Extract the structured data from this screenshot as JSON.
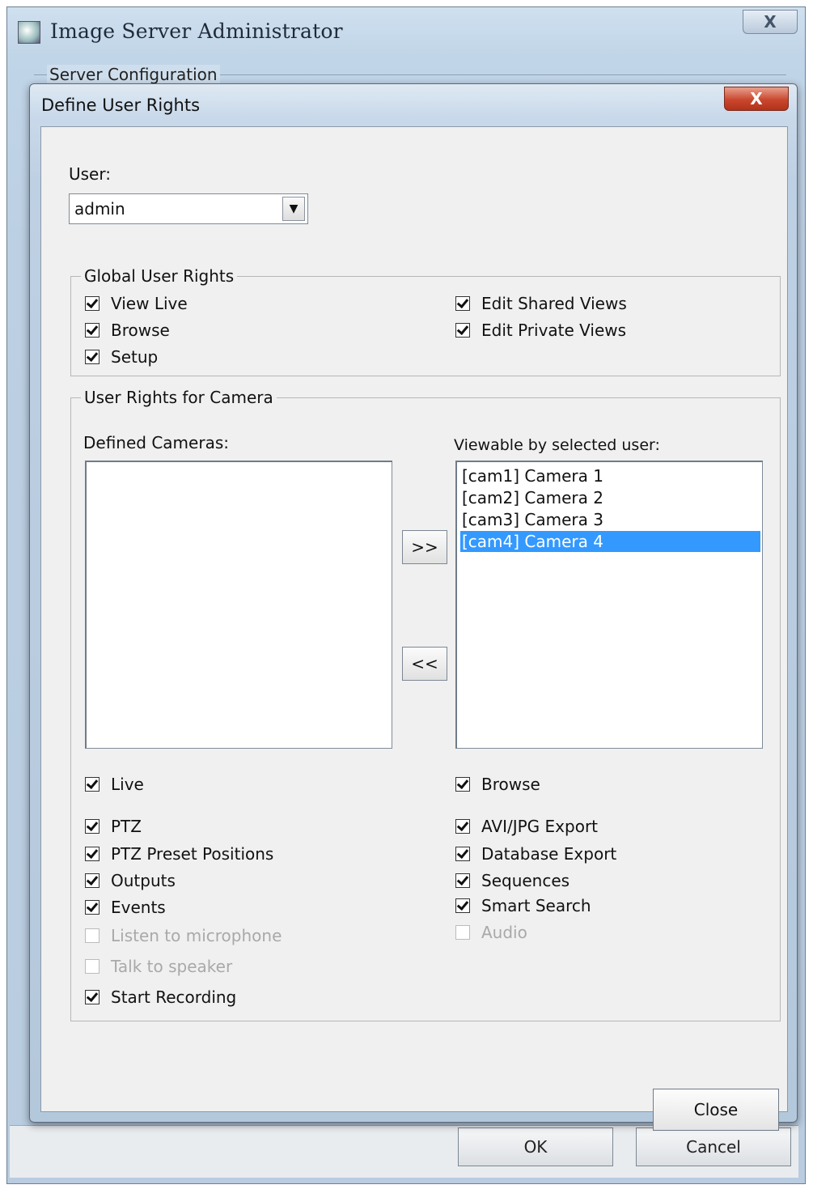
{
  "outer_window": {
    "title": "Image Server Administrator",
    "close_glyph": "X",
    "section_label": "Server Configuration",
    "ok_label": "OK",
    "cancel_label": "Cancel"
  },
  "dialog": {
    "title": "Define User Rights",
    "close_glyph": "X",
    "user_label": "User:",
    "user_value": "admin",
    "close_label": "Close"
  },
  "global_rights": {
    "legend": "Global User Rights",
    "items": [
      {
        "label": "View Live",
        "checked": true,
        "enabled": true
      },
      {
        "label": "Browse",
        "checked": true,
        "enabled": true
      },
      {
        "label": "Setup",
        "checked": true,
        "enabled": true
      },
      {
        "label": "Edit Shared Views",
        "checked": true,
        "enabled": true
      },
      {
        "label": "Edit Private Views",
        "checked": true,
        "enabled": true
      }
    ]
  },
  "camera_rights": {
    "legend": "User Rights for Camera",
    "defined_label": "Defined Cameras:",
    "viewable_label": "Viewable by selected user:",
    "defined_cameras": [],
    "viewable_cameras": [
      {
        "label": "[cam1] Camera 1",
        "selected": false
      },
      {
        "label": "[cam2] Camera 2",
        "selected": false
      },
      {
        "label": "[cam3] Camera 3",
        "selected": false
      },
      {
        "label": "[cam4] Camera 4",
        "selected": true
      }
    ],
    "add_label": ">>",
    "remove_label": "<<",
    "left_items": [
      {
        "label": "Live",
        "checked": true,
        "enabled": true
      },
      {
        "label": "PTZ",
        "checked": true,
        "enabled": true
      },
      {
        "label": "PTZ Preset Positions",
        "checked": true,
        "enabled": true
      },
      {
        "label": "Outputs",
        "checked": true,
        "enabled": true
      },
      {
        "label": "Events",
        "checked": true,
        "enabled": true
      },
      {
        "label": "Listen to microphone",
        "checked": false,
        "enabled": false
      },
      {
        "label": "Talk to speaker",
        "checked": false,
        "enabled": false
      },
      {
        "label": "Start Recording",
        "checked": true,
        "enabled": true
      }
    ],
    "right_items": [
      {
        "label": "Browse",
        "checked": true,
        "enabled": true
      },
      {
        "label": "AVI/JPG Export",
        "checked": true,
        "enabled": true
      },
      {
        "label": "Database Export",
        "checked": true,
        "enabled": true
      },
      {
        "label": "Sequences",
        "checked": true,
        "enabled": true
      },
      {
        "label": "Smart Search",
        "checked": true,
        "enabled": true
      },
      {
        "label": "Audio",
        "checked": false,
        "enabled": false
      }
    ]
  },
  "colors": {
    "selection": "#3399ff",
    "dialog_close": "#c9472e",
    "client_bg": "#f0f0f0"
  }
}
